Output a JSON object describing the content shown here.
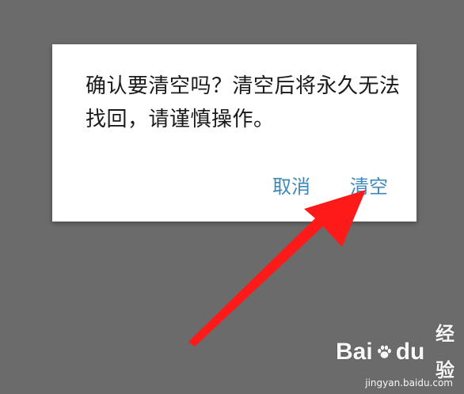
{
  "dialog": {
    "message": "确认要清空吗？清空后将永久无法找回，请谨慎操作。",
    "cancel_label": "取消",
    "confirm_label": "清空"
  },
  "watermark": {
    "brand_left": "Bai",
    "brand_right": "du",
    "brand_suffix": "经验",
    "url": "jingyan.baidu.com"
  },
  "colors": {
    "overlay": "#6b6b6b",
    "dialog_bg": "#ffffff",
    "message_text": "#1a1a1a",
    "button_text": "#3e88b8",
    "arrow": "#ff1a1a"
  },
  "icons": [
    "paw-icon",
    "pointer-arrow"
  ]
}
